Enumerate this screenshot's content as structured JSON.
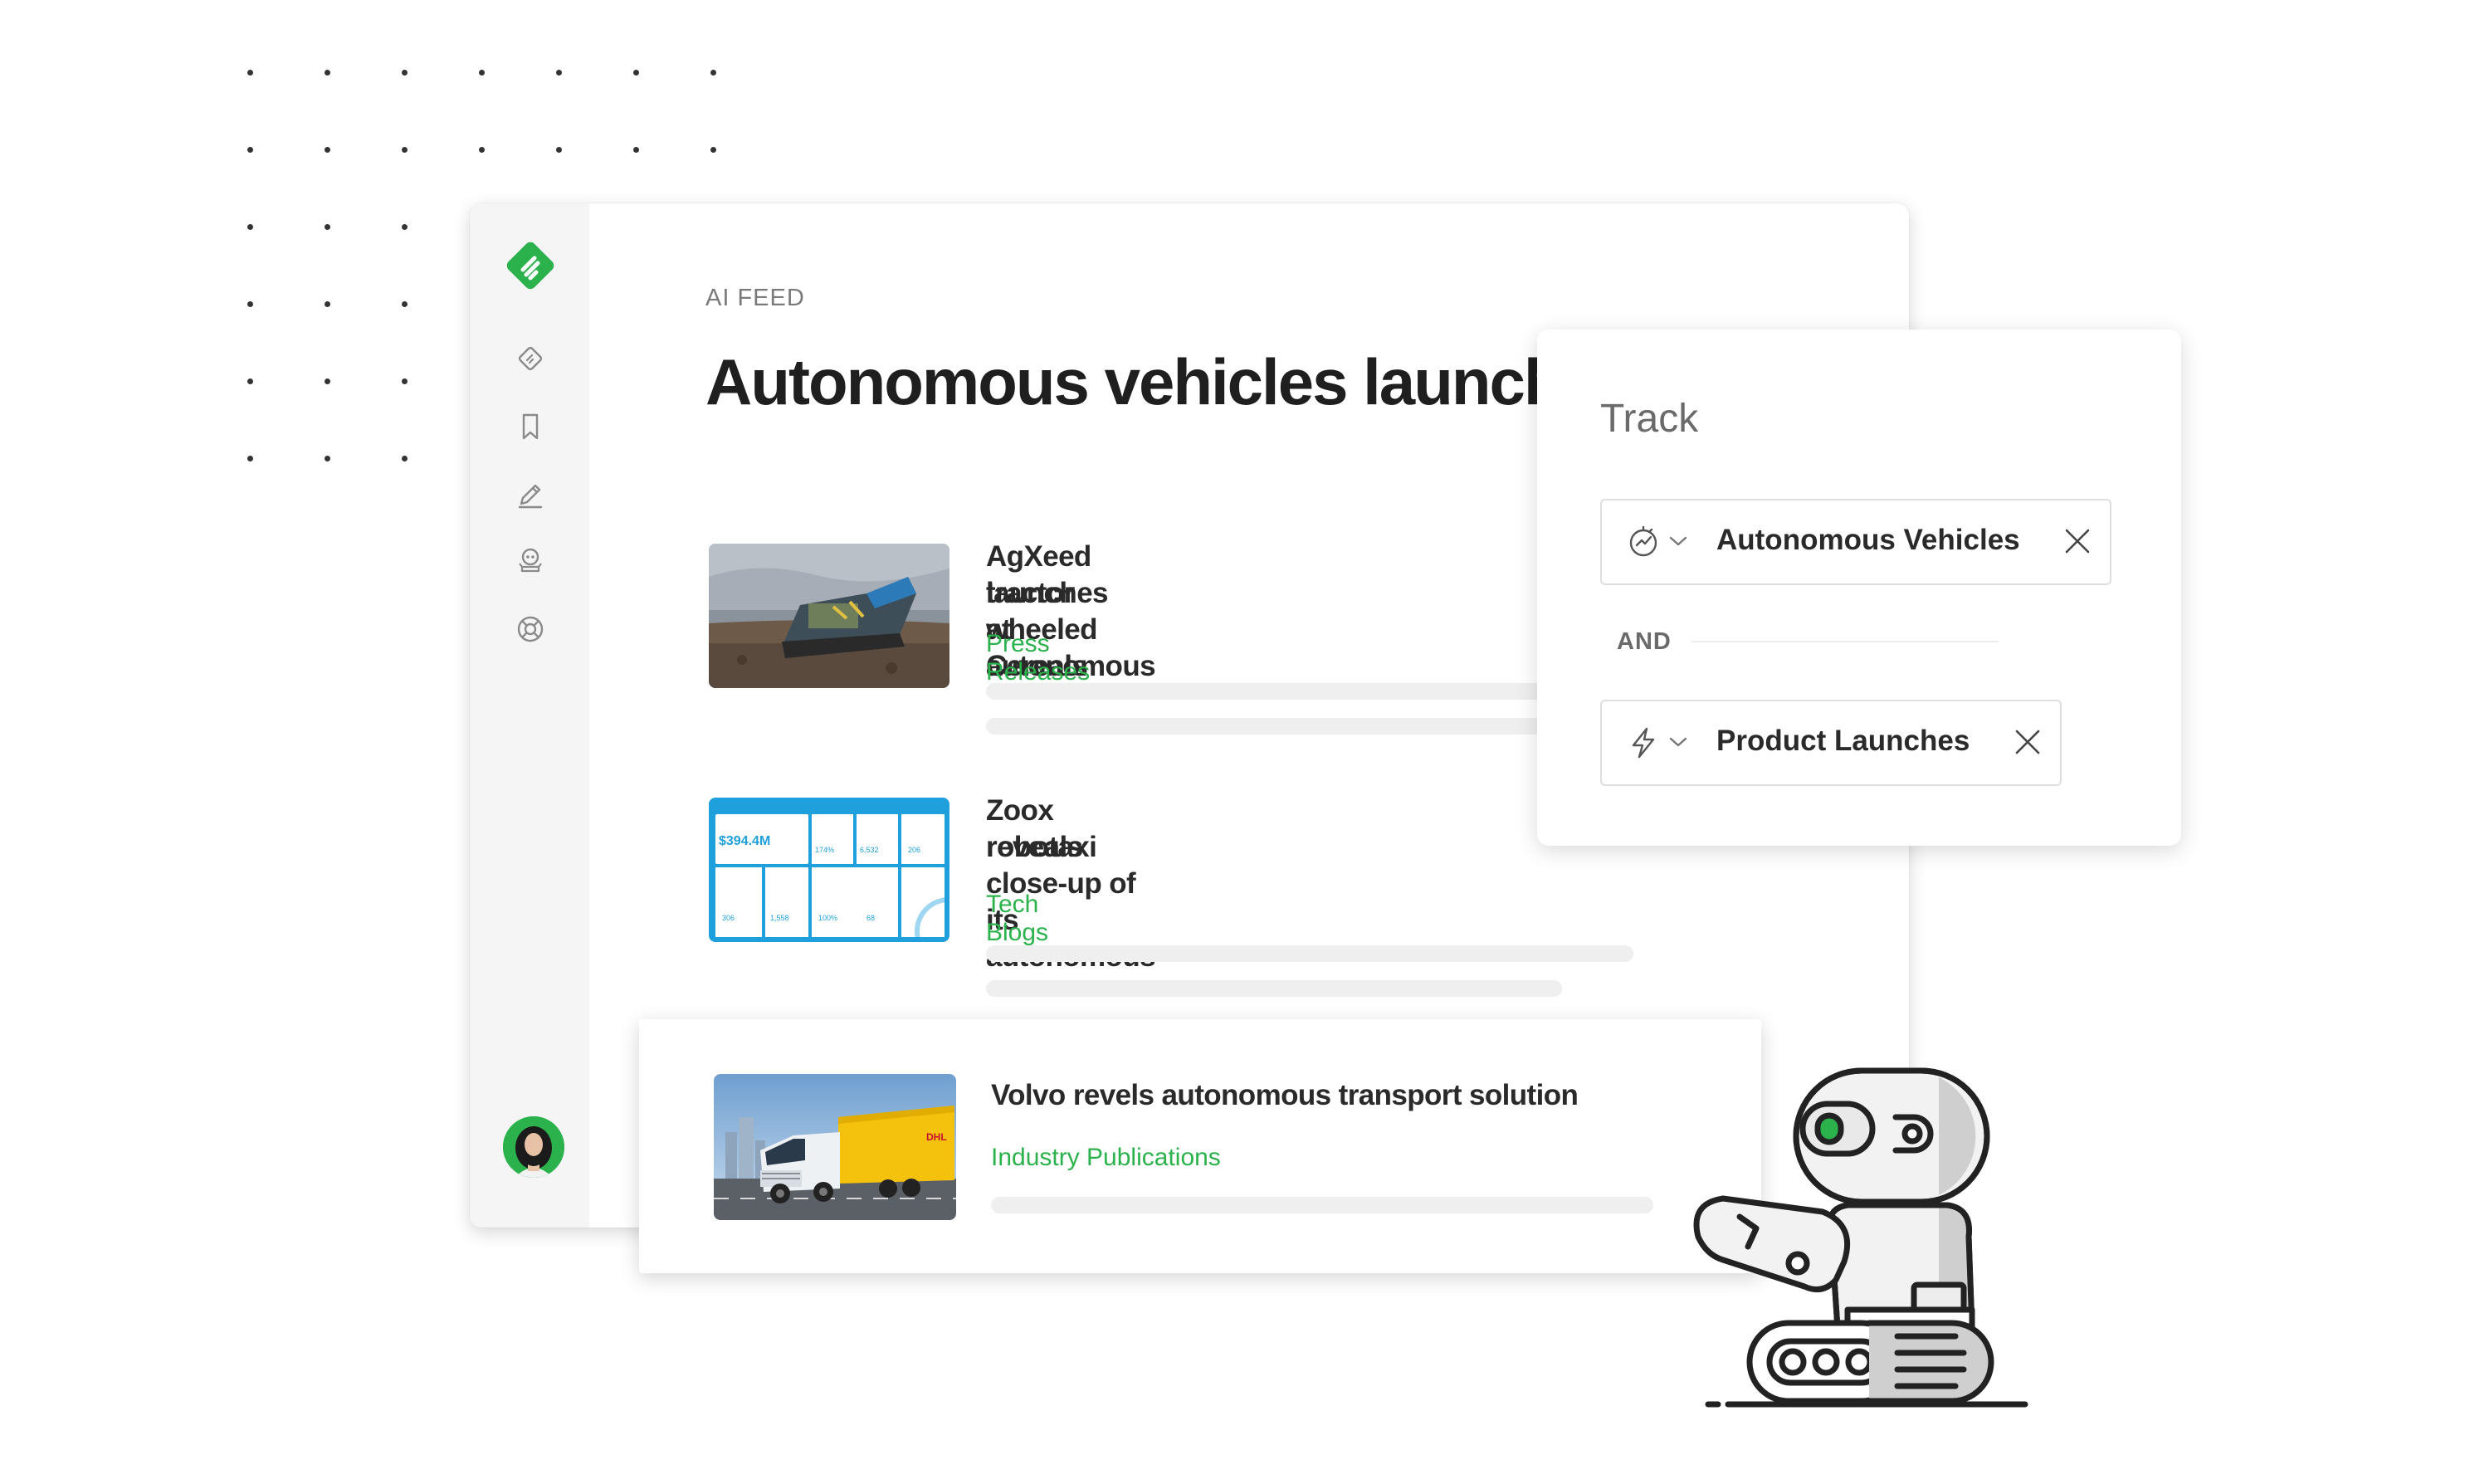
{
  "feed": {
    "label": "AI FEED",
    "title": "Autonomous vehicles launch"
  },
  "sidebar": {
    "items": [
      {
        "icon": "ai-feed-icon"
      },
      {
        "icon": "bookmark-icon"
      },
      {
        "icon": "pen-icon"
      },
      {
        "icon": "leo-robot-icon"
      },
      {
        "icon": "help-lifebuoy-icon"
      }
    ]
  },
  "articles": [
    {
      "title_line1": "AgXeed launches wheeled autonomous",
      "title_line2": "tractor at Cereals",
      "source": "Press Releases"
    },
    {
      "title_line1": "Zoox reveals close-up of its autonomous",
      "title_line2": "robotaxi",
      "source": "Tech Blogs",
      "thumb": {
        "metric_main": "$394.4M",
        "m1": "174%",
        "m2": "6,532",
        "m3": "206",
        "m4": "306",
        "m5": "1,558",
        "m6": "100%",
        "m7": "68"
      }
    },
    {
      "title_line1": "Volvo revels autonomous transport solution",
      "source": "Industry Publications"
    }
  ],
  "track": {
    "title": "Track",
    "chips": [
      {
        "label": "Autonomous Vehicles",
        "icon": "topic-icon"
      },
      {
        "label": "Product Launches",
        "icon": "lightning-icon"
      }
    ],
    "operator": "AND"
  },
  "colors": {
    "accent": "#2bb24c",
    "blue": "#1fa0dc"
  }
}
